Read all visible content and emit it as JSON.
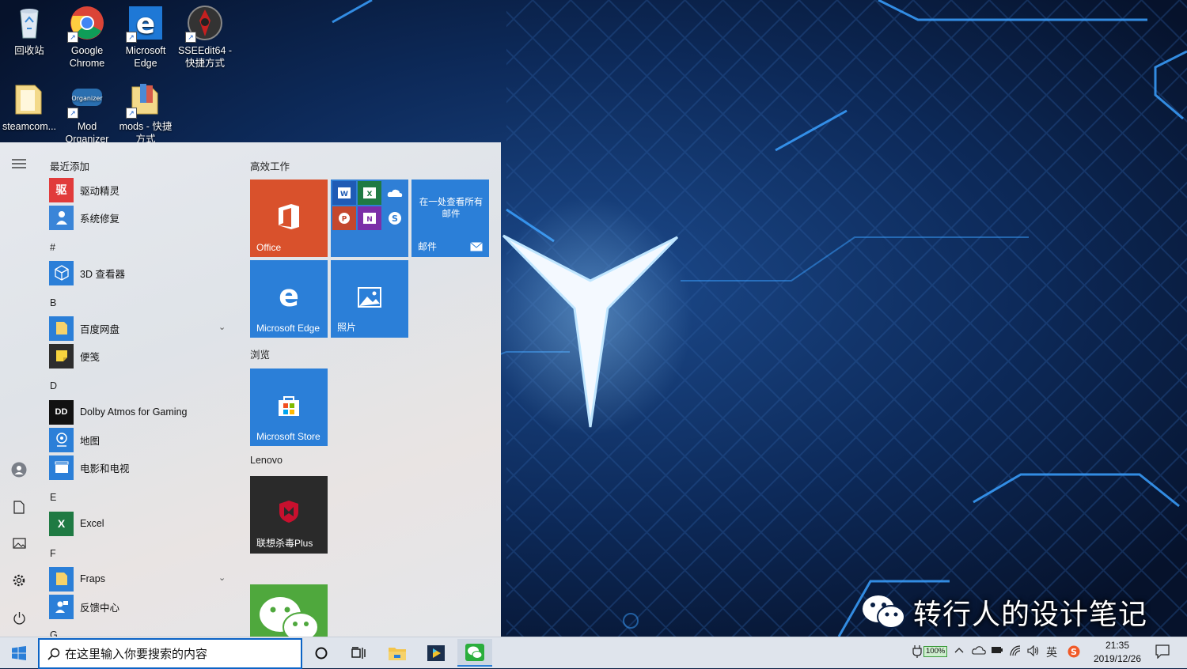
{
  "desktop": {
    "icons": [
      {
        "label": "回收站",
        "icon": "recycle-bin-icon"
      },
      {
        "label": "Google Chrome",
        "icon": "chrome-icon"
      },
      {
        "label": "Microsoft Edge",
        "icon": "edge-icon"
      },
      {
        "label": "SSEEdit64 - 快捷方式",
        "icon": "sseedit-icon"
      },
      {
        "label": "steamcom...",
        "icon": "folder-icon"
      },
      {
        "label": "Mod Organizer",
        "icon": "mod-organizer-icon"
      },
      {
        "label": "mods - 快捷方式",
        "icon": "folder-icon"
      }
    ]
  },
  "start_menu": {
    "recent_title": "最近添加",
    "apps": {
      "recent": [
        {
          "label": "驱动精灵",
          "icon": "driver-genius-icon",
          "tile_text": "驱"
        },
        {
          "label": "系统修复",
          "icon": "system-repair-icon",
          "tile_text": ""
        }
      ],
      "hash": [
        {
          "label": "3D 查看器",
          "icon": "cube-icon",
          "tile_text": ""
        }
      ],
      "b": [
        {
          "label": "百度网盘",
          "icon": "folder-icon",
          "tile_text": ""
        },
        {
          "label": "便笺",
          "icon": "sticky-note-icon",
          "tile_text": ""
        }
      ],
      "d": [
        {
          "label": "Dolby Atmos for Gaming",
          "icon": "dolby-icon",
          "tile_text": "DD"
        },
        {
          "label": "地图",
          "icon": "maps-icon",
          "tile_text": ""
        },
        {
          "label": "电影和电视",
          "icon": "movies-icon",
          "tile_text": ""
        }
      ],
      "e": [
        {
          "label": "Excel",
          "icon": "excel-icon",
          "tile_text": "X"
        }
      ],
      "f": [
        {
          "label": "Fraps",
          "icon": "folder-icon",
          "tile_text": ""
        },
        {
          "label": "反馈中心",
          "icon": "feedback-icon",
          "tile_text": ""
        }
      ]
    },
    "letters": {
      "hash": "#",
      "b": "B",
      "d": "D",
      "e": "E",
      "f": "F",
      "g": "G"
    },
    "groups": {
      "productivity": "高效工作",
      "browse": "浏览",
      "lenovo": "Lenovo"
    },
    "tiles": {
      "office": "Office",
      "mail_heading": "在一处查看所有邮件",
      "mail": "邮件",
      "edge": "Microsoft Edge",
      "photos": "照片",
      "store": "Microsoft Store",
      "antivirus": "联想杀毒Plus"
    }
  },
  "taskbar": {
    "search_placeholder": "在这里输入你要搜索的内容",
    "battery": "100%",
    "ime": "英",
    "time": "21:35",
    "date": "2019/12/26"
  },
  "watermark": {
    "text": "转行人的设计笔记"
  },
  "colors": {
    "accent": "#2b7fd8",
    "office": "#d9512c",
    "taskbar": "#dfe4ec",
    "wallpaper": "#0a1f44"
  }
}
